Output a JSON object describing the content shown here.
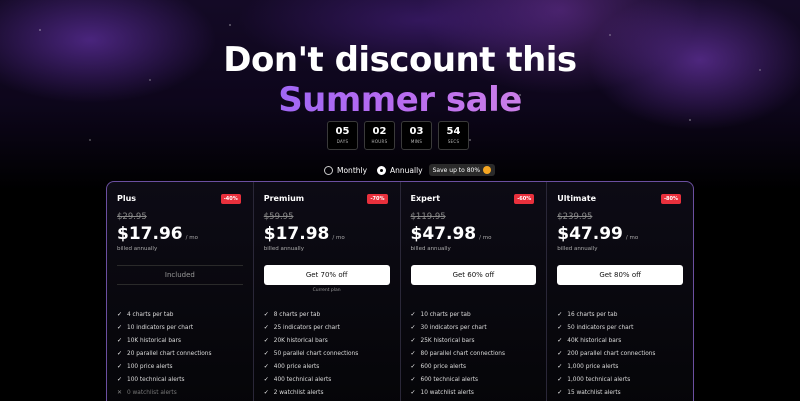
{
  "headline": {
    "line1": "Don't discount this",
    "line2": "Summer sale"
  },
  "countdown": [
    {
      "value": "05",
      "label": "DAYS"
    },
    {
      "value": "02",
      "label": "HOURS"
    },
    {
      "value": "03",
      "label": "MINS"
    },
    {
      "value": "54",
      "label": "SECS"
    }
  ],
  "billing": {
    "monthly_label": "Monthly",
    "annually_label": "Annually",
    "selected": "Annually",
    "save_badge": "Save up to 80%"
  },
  "plans": [
    {
      "name": "Plus",
      "discount": "-40%",
      "old_price": "$29.95",
      "price": "$17.96",
      "per": "/ mo",
      "billed": "billed annually",
      "cta": "Included",
      "note": "",
      "features": [
        {
          "text": "4 charts per tab",
          "included": true
        },
        {
          "text": "10 indicators per chart",
          "included": true
        },
        {
          "text": "10K historical bars",
          "included": true
        },
        {
          "text": "20 parallel chart connections",
          "included": true
        },
        {
          "text": "100 price alerts",
          "included": true
        },
        {
          "text": "100 technical alerts",
          "included": true
        },
        {
          "text": "0 watchlist alerts",
          "included": false
        }
      ]
    },
    {
      "name": "Premium",
      "discount": "-70%",
      "old_price": "$59.95",
      "price": "$17.98",
      "per": "/ mo",
      "billed": "billed annually",
      "cta": "Get 70% off",
      "note": "Current plan",
      "features": [
        {
          "text": "8 charts per tab",
          "included": true
        },
        {
          "text": "25 indicators per chart",
          "included": true
        },
        {
          "text": "20K historical bars",
          "included": true
        },
        {
          "text": "50 parallel chart connections",
          "included": true
        },
        {
          "text": "400 price alerts",
          "included": true
        },
        {
          "text": "400 technical alerts",
          "included": true
        },
        {
          "text": "2 watchlist alerts",
          "included": true
        }
      ]
    },
    {
      "name": "Expert",
      "discount": "-60%",
      "old_price": "$119.95",
      "price": "$47.98",
      "per": "/ mo",
      "billed": "billed annually",
      "cta": "Get 60% off",
      "note": "",
      "features": [
        {
          "text": "10 charts per tab",
          "included": true
        },
        {
          "text": "30 indicators per chart",
          "included": true
        },
        {
          "text": "25K historical bars",
          "included": true
        },
        {
          "text": "80 parallel chart connections",
          "included": true
        },
        {
          "text": "600 price alerts",
          "included": true
        },
        {
          "text": "600 technical alerts",
          "included": true
        },
        {
          "text": "10 watchlist alerts",
          "included": true
        }
      ]
    },
    {
      "name": "Ultimate",
      "discount": "-80%",
      "old_price": "$239.95",
      "price": "$47.99",
      "per": "/ mo",
      "billed": "billed annually",
      "cta": "Get 80% off",
      "note": "",
      "features": [
        {
          "text": "16 charts per tab",
          "included": true
        },
        {
          "text": "50 indicators per chart",
          "included": true
        },
        {
          "text": "40K historical bars",
          "included": true
        },
        {
          "text": "200 parallel chart connections",
          "included": true
        },
        {
          "text": "1,000 price alerts",
          "included": true
        },
        {
          "text": "1,000 technical alerts",
          "included": true
        },
        {
          "text": "15 watchlist alerts",
          "included": true
        }
      ]
    }
  ],
  "colors": {
    "discount_badge": "#e9303c",
    "accent_gradient_start": "#6a5cff",
    "accent_gradient_end": "#f7a9d4",
    "card_border": "#6b4fa0"
  }
}
